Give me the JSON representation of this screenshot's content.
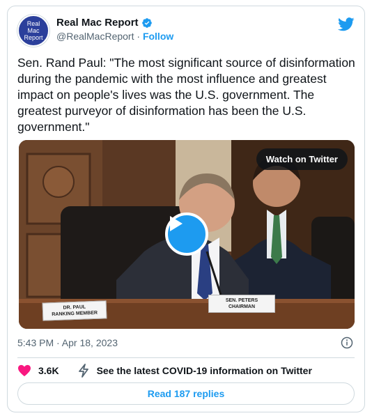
{
  "author": {
    "avatar_text": [
      "Real",
      "Mac",
      "Report"
    ],
    "display_name": "Real Mac Report",
    "handle": "@RealMacReport",
    "separator": " · ",
    "follow_label": "Follow"
  },
  "tweet": {
    "text": "Sen. Rand Paul: \"The most significant source of disinformation during the pandemic with the most influence and greatest impact on people's lives was the U.S. government. The greatest purveyor of disinformation has been the U.S. government.\""
  },
  "media": {
    "watch_label": "Watch on Twitter",
    "nameplate_left": [
      "DR. PAUL",
      "RANKING MEMBER"
    ],
    "nameplate_right": [
      "SEN. PETERS",
      "CHAIRMAN"
    ]
  },
  "meta": {
    "timestamp": "5:43 PM · Apr 18, 2023"
  },
  "actions": {
    "like_count": "3.6K",
    "covid_label": "See the latest COVID-19 information on Twitter"
  },
  "replies": {
    "label": "Read 187 replies"
  },
  "colors": {
    "accent": "#1d9bf0",
    "like": "#f91880",
    "secondary_text": "#536471",
    "border": "#cfd9de"
  },
  "icons": [
    "verified-badge-icon",
    "twitter-bird-icon",
    "play-icon",
    "info-icon",
    "heart-icon",
    "lightning-icon"
  ]
}
